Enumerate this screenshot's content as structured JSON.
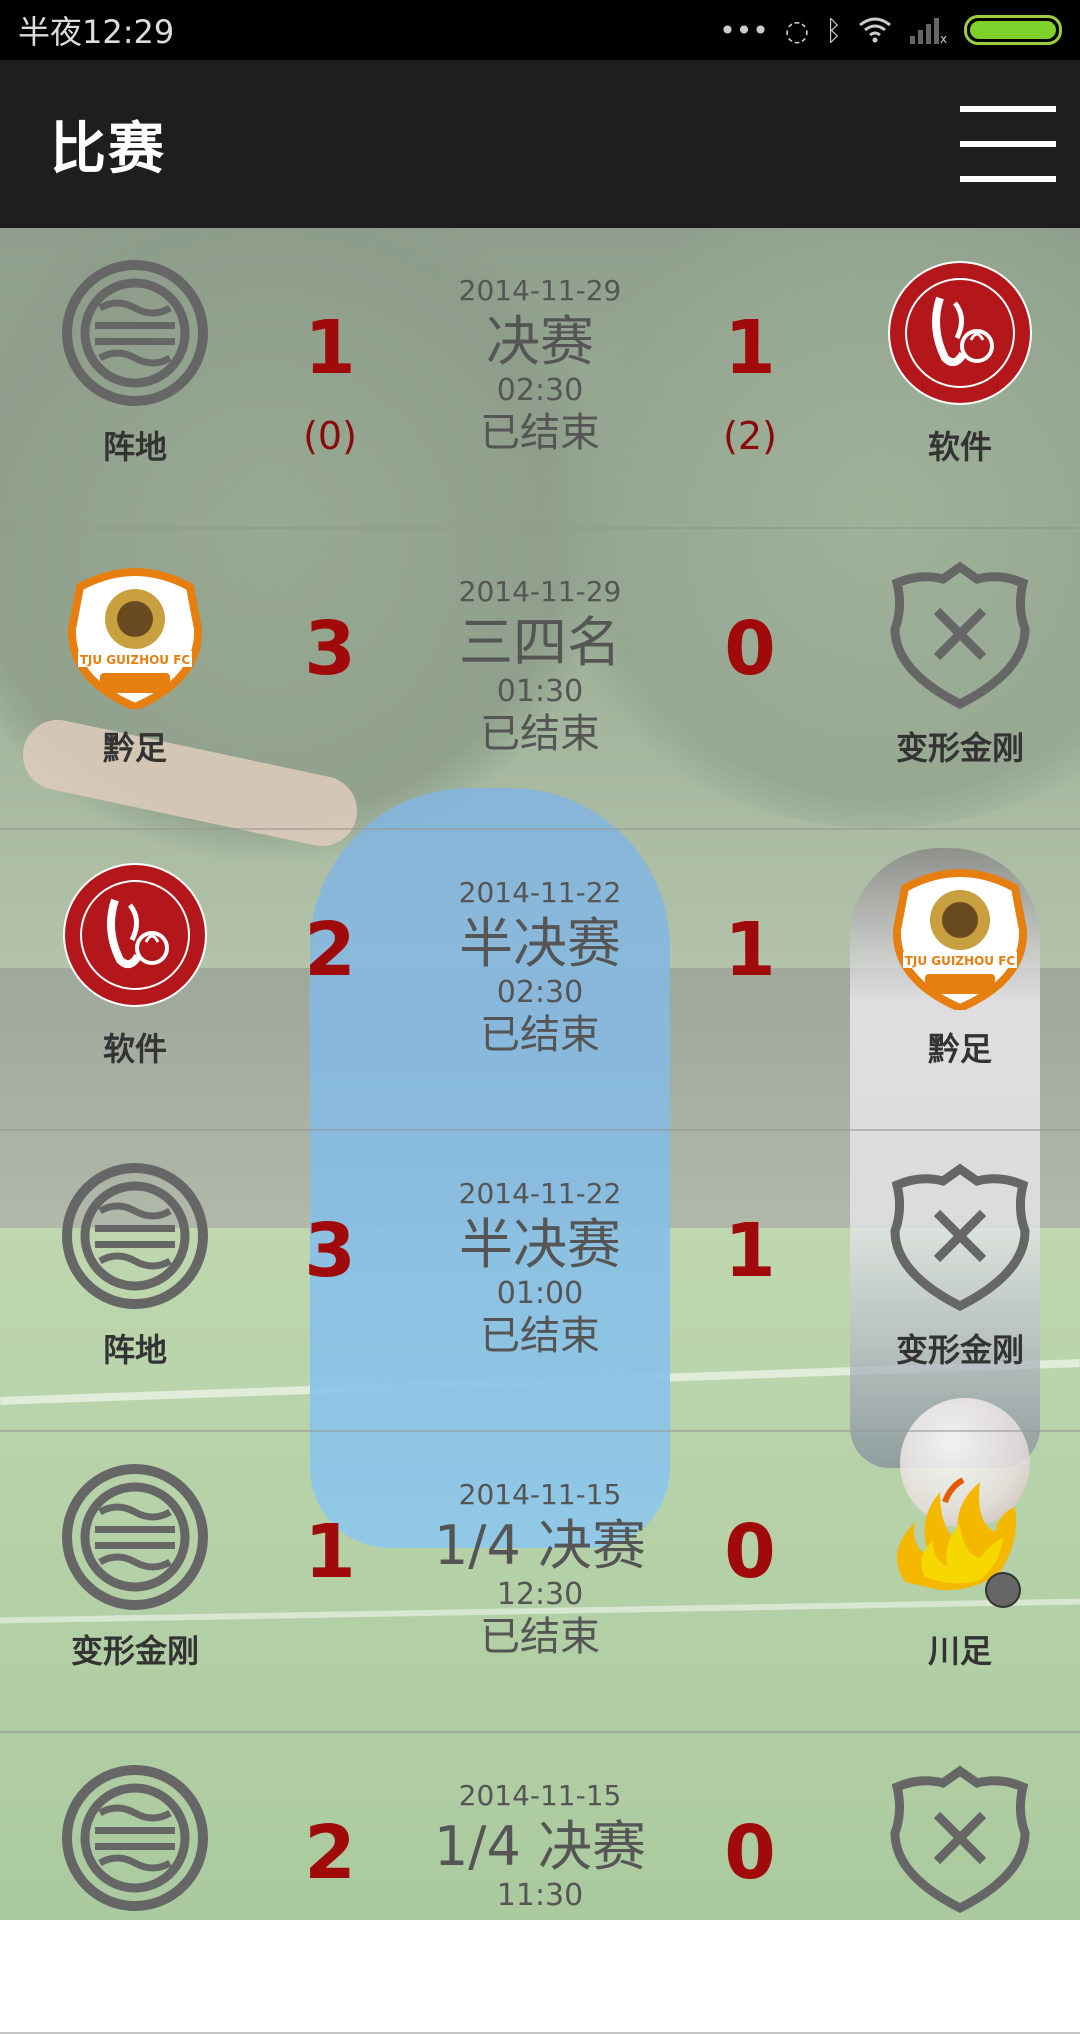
{
  "status_bar": {
    "time": "半夜12:29",
    "icons": [
      "more-dots-icon",
      "sync-icon",
      "bluetooth-icon",
      "wifi-icon",
      "signal-icon",
      "battery-icon"
    ]
  },
  "app_bar": {
    "title": "比赛",
    "menu_icon": "hamburger-menu-icon"
  },
  "colors": {
    "score": "#a00a0a",
    "app_bar": "#1e1e1e",
    "status_bar": "#000000"
  },
  "matches": [
    {
      "date": "2014-11-29",
      "round": "决赛",
      "time": "02:30",
      "status": "已结束",
      "home": {
        "name": "阵地",
        "logo": "zhendi-logo",
        "score": "1",
        "penalty": "(0)"
      },
      "away": {
        "name": "软件",
        "logo": "ruanjian-logo",
        "score": "1",
        "penalty": "(2)"
      }
    },
    {
      "date": "2014-11-29",
      "round": "三四名",
      "time": "01:30",
      "status": "已结束",
      "home": {
        "name": "黔足",
        "logo": "qianzu-logo",
        "score": "3",
        "penalty": ""
      },
      "away": {
        "name": "变形金刚",
        "logo": "shield-x-logo",
        "score": "0",
        "penalty": ""
      }
    },
    {
      "date": "2014-11-22",
      "round": "半决赛",
      "time": "02:30",
      "status": "已结束",
      "home": {
        "name": "软件",
        "logo": "ruanjian-logo",
        "score": "2",
        "penalty": ""
      },
      "away": {
        "name": "黔足",
        "logo": "qianzu-logo",
        "score": "1",
        "penalty": ""
      }
    },
    {
      "date": "2014-11-22",
      "round": "半决赛",
      "time": "01:00",
      "status": "已结束",
      "home": {
        "name": "阵地",
        "logo": "zhendi-logo",
        "score": "3",
        "penalty": ""
      },
      "away": {
        "name": "变形金刚",
        "logo": "shield-x-logo",
        "score": "1",
        "penalty": ""
      }
    },
    {
      "date": "2014-11-15",
      "round": "1/4 决赛",
      "time": "12:30",
      "status": "已结束",
      "home": {
        "name": "变形金刚",
        "logo": "zhendi-logo",
        "score": "1",
        "penalty": ""
      },
      "away": {
        "name": "川足",
        "logo": "chuanzu-logo",
        "score": "0",
        "penalty": ""
      }
    },
    {
      "date": "2014-11-15",
      "round": "1/4 决赛",
      "time": "11:30",
      "status": "",
      "home": {
        "name": "",
        "logo": "zhendi-logo",
        "score": "2",
        "penalty": ""
      },
      "away": {
        "name": "",
        "logo": "shield-x-logo",
        "score": "0",
        "penalty": ""
      }
    }
  ]
}
